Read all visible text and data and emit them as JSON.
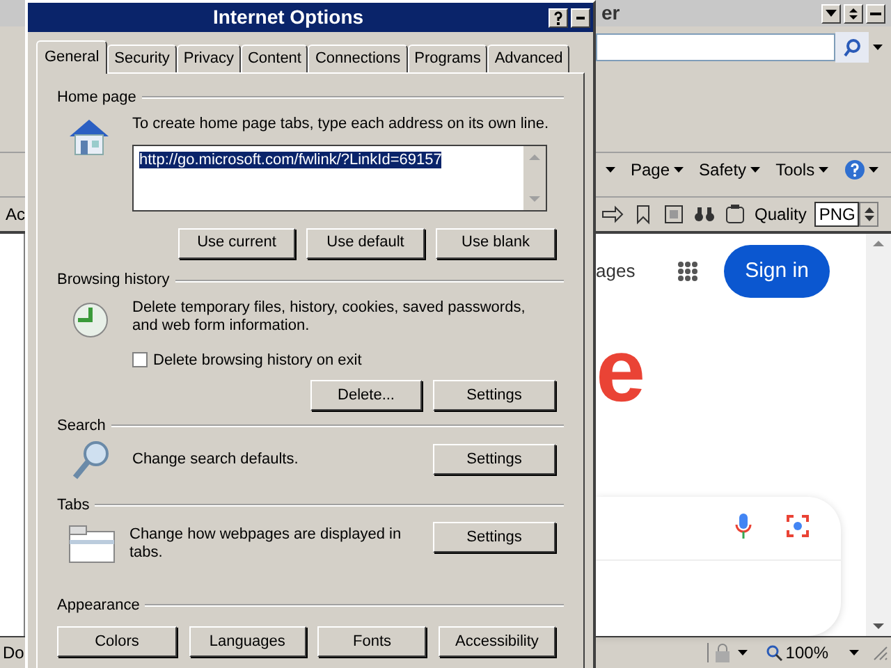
{
  "browser": {
    "title_fragment": "er",
    "command_bar": [
      {
        "label": "Page"
      },
      {
        "label": "Safety"
      },
      {
        "label": "Tools"
      }
    ],
    "quality_label": "Quality",
    "quality_value": "PNG",
    "left_fragment": "Ac",
    "nav_fragment": "ages",
    "sign_in": "Sign in",
    "logo_fragment": "e",
    "status_fragment": "Do",
    "zoom": "100%"
  },
  "dialog": {
    "title": "Internet Options",
    "tabs": [
      {
        "label": "General",
        "selected": true
      },
      {
        "label": "Security",
        "selected": false
      },
      {
        "label": "Privacy",
        "selected": false
      },
      {
        "label": "Content",
        "selected": false
      },
      {
        "label": "Connections",
        "selected": false
      },
      {
        "label": "Programs",
        "selected": false
      },
      {
        "label": "Advanced",
        "selected": false
      }
    ],
    "home_page": {
      "heading": "Home page",
      "instruction": "To create home page tabs, type each address on its own line.",
      "url": "http://go.microsoft.com/fwlink/?LinkId=69157",
      "buttons": [
        "Use current",
        "Use default",
        "Use blank"
      ]
    },
    "browsing_history": {
      "heading": "Browsing history",
      "text": "Delete temporary files, history, cookies, saved passwords, and web form information.",
      "checkbox": {
        "label": "Delete browsing history on exit",
        "checked": false
      },
      "buttons": [
        "Delete...",
        "Settings"
      ]
    },
    "search": {
      "heading": "Search",
      "text": "Change search defaults.",
      "button": "Settings"
    },
    "tabs_section": {
      "heading": "Tabs",
      "text": "Change how webpages are displayed in tabs.",
      "button": "Settings"
    },
    "appearance": {
      "heading": "Appearance",
      "buttons": [
        "Colors",
        "Languages",
        "Fonts",
        "Accessibility"
      ]
    }
  }
}
